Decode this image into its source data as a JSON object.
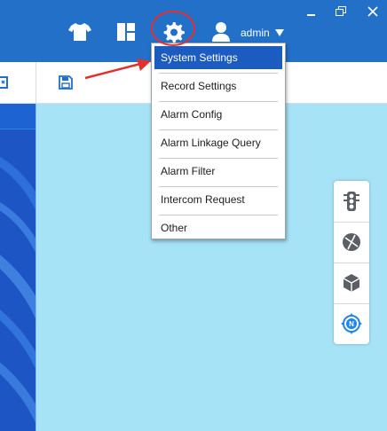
{
  "topbar": {
    "user_name": "admin",
    "icons": [
      "tshirt-icon",
      "layout-icon",
      "gear-icon",
      "user-icon"
    ],
    "window_controls": [
      "minimize-icon",
      "restore-icon",
      "close-icon"
    ]
  },
  "toolbar": {
    "icons": [
      "expand-icon",
      "save-icon"
    ]
  },
  "menu": {
    "items": [
      {
        "label": "System Settings",
        "active": true
      },
      {
        "label": "Record Settings"
      },
      {
        "label": "Alarm Config"
      },
      {
        "label": "Alarm Linkage Query"
      },
      {
        "label": "Alarm Filter"
      },
      {
        "label": "Intercom Request"
      },
      {
        "label": "Other"
      }
    ]
  },
  "float_tools": {
    "icons": [
      "traffic-light-icon",
      "sphere-icon",
      "cube-icon",
      "compass-icon"
    ]
  },
  "colors": {
    "topbar": "#2370c8",
    "menu_active": "#1c5bbf",
    "canvas": "#a6e3f7",
    "annotation": "#e0312f"
  }
}
